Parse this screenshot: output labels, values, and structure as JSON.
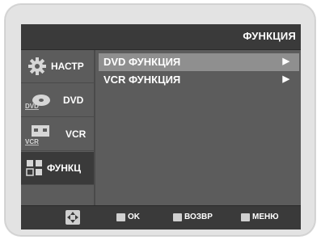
{
  "header": {
    "title": "ФУНКЦИЯ"
  },
  "sidebar": {
    "items": [
      {
        "label": "НАСТР",
        "icon": "gear-icon"
      },
      {
        "label": "DVD",
        "icon": "dvd-disc-icon",
        "icon_text": "DVD"
      },
      {
        "label": "VCR",
        "icon": "vcr-cassette-icon",
        "icon_text": "VCR"
      },
      {
        "label": "ФУНКЦ",
        "icon": "function-grid-icon",
        "selected": true
      }
    ]
  },
  "menu": {
    "items": [
      {
        "label": "DVD ФУНКЦИЯ",
        "arrow": "▶",
        "selected": true
      },
      {
        "label": "VCR ФУНКЦИЯ",
        "arrow": "▶",
        "selected": false
      }
    ]
  },
  "footer": {
    "navigate_icon": "dpad-navigate-icon",
    "ok_label": "OK",
    "back_label": "ВОЗВР",
    "menu_label": "МЕНЮ"
  },
  "colors": {
    "panel": "#5c5c5c",
    "bar": "#3a3a3a",
    "highlight": "#8f8f8f",
    "text": "#ffffff",
    "bezel": "#e3e3e3"
  }
}
